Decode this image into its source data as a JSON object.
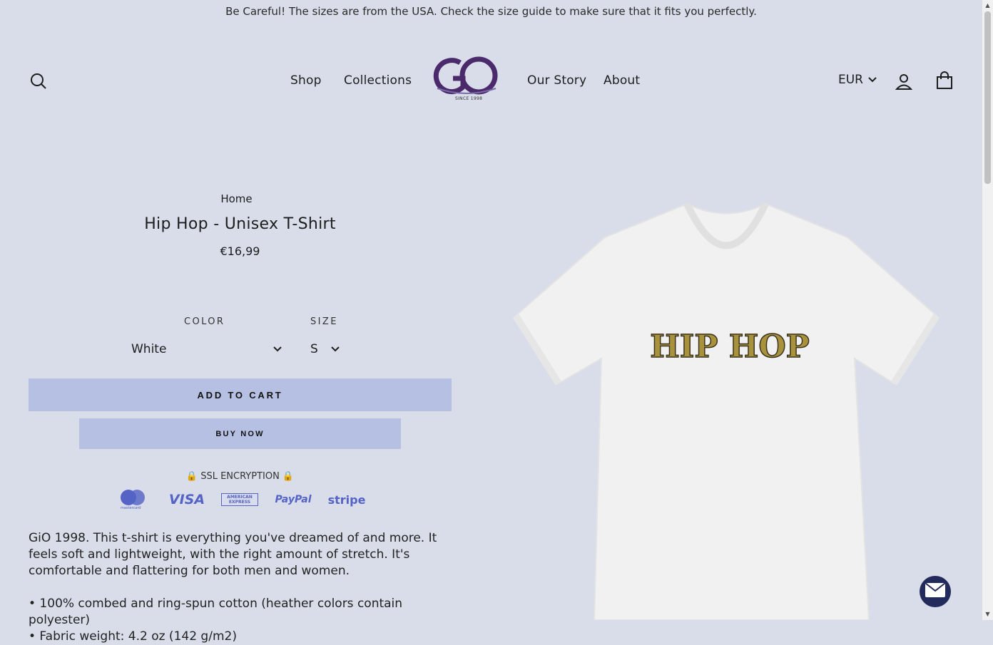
{
  "announcement": "Be Careful! The sizes are from the USA. Check the size guide to make sure that it fits you perfectly.",
  "nav": {
    "items": [
      {
        "label": "Shop"
      },
      {
        "label": "Collections"
      },
      {
        "label": "Our Story"
      },
      {
        "label": "About"
      }
    ],
    "logo_text": "GO",
    "logo_subtext": "SINCE 1998",
    "currency": "EUR"
  },
  "product": {
    "breadcrumb": "Home",
    "title": "Hip Hop - Unisex T-Shirt",
    "price": "€16,99",
    "color_label": "COLOR",
    "color_value": "White",
    "size_label": "SIZE",
    "size_value": "S",
    "add_to_cart": "ADD TO CART",
    "buy_now": "BUY NOW",
    "ssl_text": "🔒 SSL ENCRYPTION 🔒",
    "payment_methods": [
      "mastercard",
      "VISA",
      "AMERICAN EXPRESS",
      "PayPal",
      "stripe"
    ],
    "description": "GiO 1998. This t-shirt is everything you've dreamed of and more. It feels soft and lightweight, with the right amount of stretch. It's comfortable and flattering for both men and women.",
    "features": [
      "• 100% combed and ring-spun cotton (heather colors contain polyester)",
      "• Fabric weight: 4.2 oz (142 g/m2)"
    ],
    "print_text": "HIP HOP"
  },
  "colors": {
    "background": "#d8dde9",
    "button": "#b6c0e2",
    "logo_purple": "#4b2a6b",
    "payment_blue": "#5463c5",
    "chat_button": "#232a5c"
  }
}
